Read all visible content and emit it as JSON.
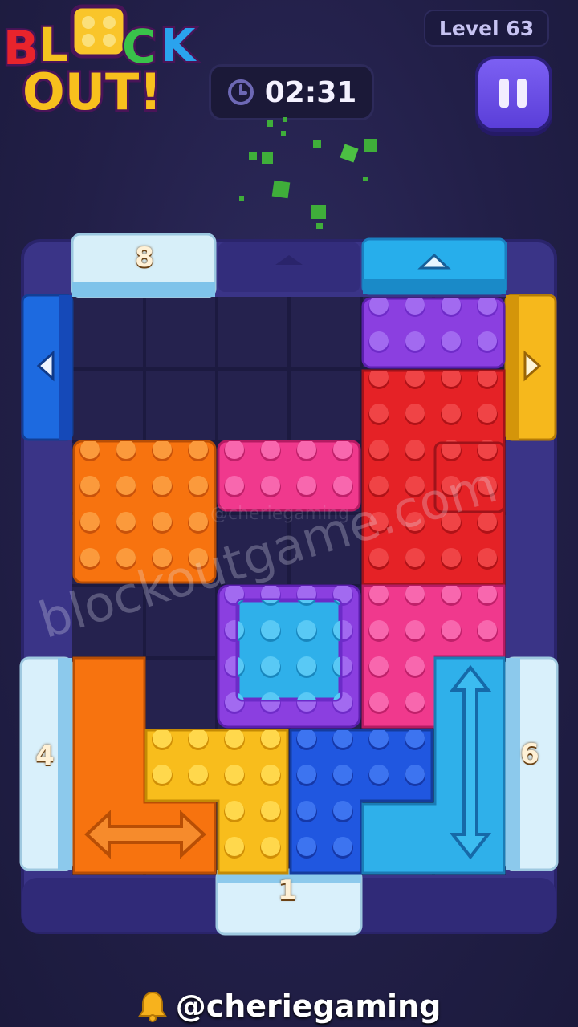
{
  "game": {
    "title_line1": "BLOCK",
    "title_line2": "OUT!",
    "level_label": "Level 63",
    "timer": "02:31"
  },
  "gates": {
    "top_left_count": "8",
    "left_count": "4",
    "right_count": "6",
    "bottom_count": "1"
  },
  "watermarks": {
    "site": "blockoutgame.com",
    "handle_faint": "@cheriegaming"
  },
  "footer": {
    "handle": "@cheriegaming"
  },
  "icons": {
    "timer": "clock-icon",
    "pause": "pause-icon",
    "footer": "bell-icon"
  },
  "colors": {
    "background": "#221f48",
    "board_frame": "#3a3487",
    "purple_block": "#8b3fe0",
    "red_block": "#e52226",
    "orange_block": "#f7730f",
    "pink_block": "#f0398d",
    "cyan_block": "#2fb0ea",
    "yellow_block": "#f8bd1c",
    "blue_block": "#2057e0",
    "blue_gate": "#1d6ae0",
    "yellow_gate": "#f6b81c",
    "ice_gate": "#d9f0fb"
  }
}
